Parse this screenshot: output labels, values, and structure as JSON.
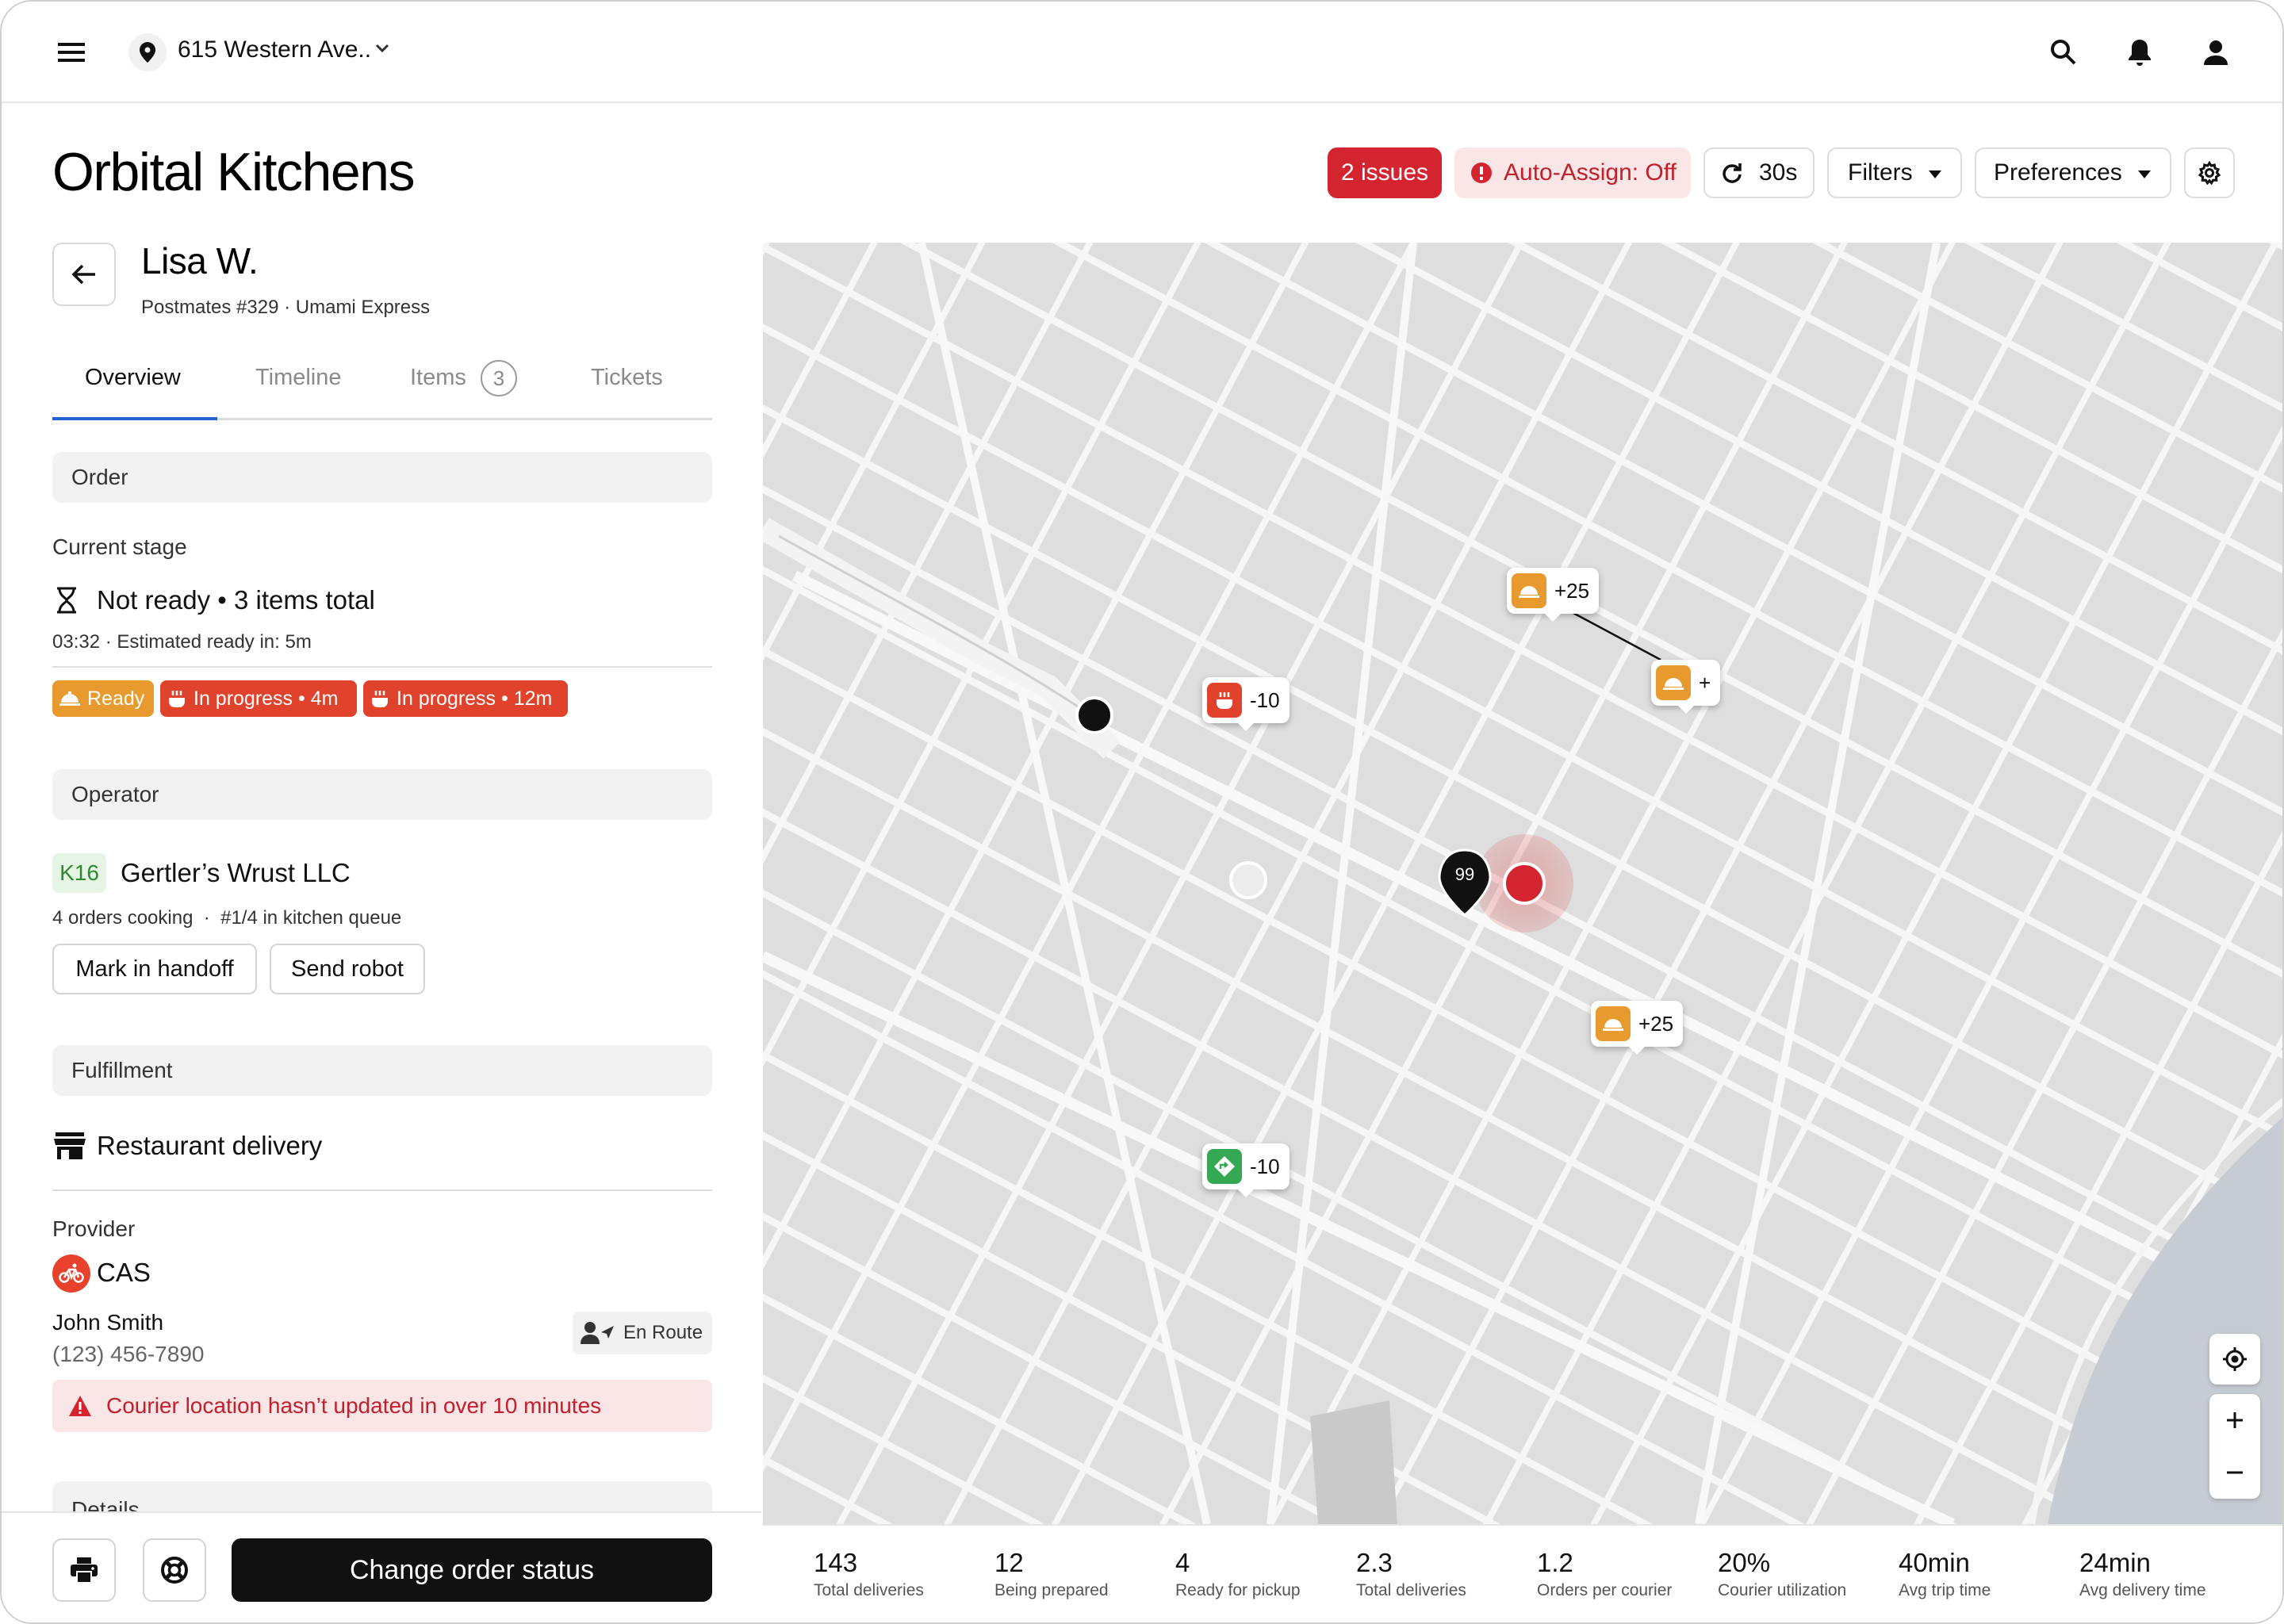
{
  "topbar": {
    "address": "615 Western Ave.."
  },
  "header": {
    "title": "Orbital Kitchens",
    "issues": "2 issues",
    "auto_assign": "Auto-Assign: Off",
    "refresh": "30s",
    "filters": "Filters",
    "preferences": "Preferences"
  },
  "customer": {
    "name": "Lisa W.",
    "subtitle": "Postmates #329 · Umami Express"
  },
  "tabs": [
    {
      "label": "Overview"
    },
    {
      "label": "Timeline"
    },
    {
      "label": "Items",
      "badge": "3"
    },
    {
      "label": "Tickets"
    }
  ],
  "order": {
    "section": "Order",
    "stage_label": "Current stage",
    "stage": "Not ready • 3 items total",
    "time": "03:32 · Estimated ready in: 5m",
    "badges": [
      "Ready",
      "In progress • 4m",
      "In progress • 12m"
    ]
  },
  "operator": {
    "section": "Operator",
    "code": "K16",
    "name": "Gertler’s Wrust LLC",
    "details": "4 orders cooking  ·  #1/4 in kitchen queue",
    "btn_handoff": "Mark in handoff",
    "btn_robot": "Send robot"
  },
  "fulfillment": {
    "section": "Fulfillment",
    "method": "Restaurant delivery",
    "provider_label": "Provider",
    "provider": "CAS",
    "courier_name": "John Smith",
    "courier_phone": "(123) 456-7890",
    "status": "En Route",
    "alert": "Courier location hasn’t updated in over 10 minutes"
  },
  "details_section": "Details",
  "footer": {
    "primary": "Change order status"
  },
  "map": {
    "markers": [
      {
        "type": "food-ready",
        "label": "+25"
      },
      {
        "type": "food-ready",
        "label": "+"
      },
      {
        "type": "cooking",
        "label": "-10"
      },
      {
        "type": "food-ready",
        "label": "+25"
      },
      {
        "type": "dropoff",
        "label": "-10"
      }
    ],
    "pin_label": "99"
  },
  "stats": [
    {
      "value": "143",
      "label": "Total deliveries"
    },
    {
      "value": "12",
      "label": "Being prepared"
    },
    {
      "value": "4",
      "label": "Ready for pickup"
    },
    {
      "value": "2.3",
      "label": "Total deliveries"
    },
    {
      "value": "1.2",
      "label": "Orders per courier"
    },
    {
      "value": "20%",
      "label": "Courier utilization"
    },
    {
      "value": "40min",
      "label": "Avg trip time"
    },
    {
      "value": "24min",
      "label": "Avg delivery time"
    }
  ],
  "colors": {
    "danger": "#d42430",
    "ready": "#e89a2e",
    "in_progress": "#e0422b",
    "tab_active": "#1f62d0",
    "operator_code": "#2d8a2d",
    "dropoff": "#34a853"
  }
}
